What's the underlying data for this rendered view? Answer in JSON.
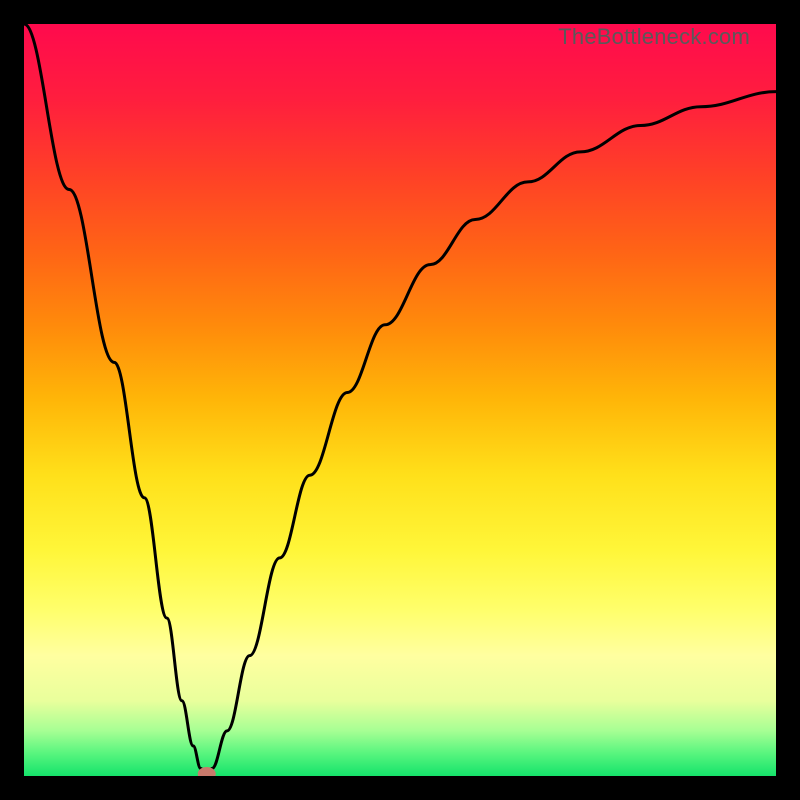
{
  "watermark": "TheBottleneck.com",
  "chart_data": {
    "type": "line",
    "title": "",
    "xlabel": "",
    "ylabel": "",
    "xlim": [
      0,
      100
    ],
    "ylim": [
      0,
      100
    ],
    "gradient_bands": [
      {
        "y": 0,
        "color": "#ff0a4d"
      },
      {
        "y": 10,
        "color": "#ff1e3e"
      },
      {
        "y": 20,
        "color": "#ff4027"
      },
      {
        "y": 30,
        "color": "#ff6316"
      },
      {
        "y": 40,
        "color": "#ff8a0b"
      },
      {
        "y": 50,
        "color": "#ffb608"
      },
      {
        "y": 60,
        "color": "#ffe01a"
      },
      {
        "y": 70,
        "color": "#fff639"
      },
      {
        "y": 78,
        "color": "#ffff6c"
      },
      {
        "y": 84,
        "color": "#ffffa0"
      },
      {
        "y": 90,
        "color": "#e9ff9c"
      },
      {
        "y": 94,
        "color": "#a6ff94"
      },
      {
        "y": 97,
        "color": "#58f57e"
      },
      {
        "y": 100,
        "color": "#15e36b"
      }
    ],
    "series": [
      {
        "name": "bottleneck-curve",
        "data": [
          {
            "x": 0,
            "y": 100
          },
          {
            "x": 6,
            "y": 78
          },
          {
            "x": 12,
            "y": 55
          },
          {
            "x": 16,
            "y": 37
          },
          {
            "x": 19,
            "y": 21
          },
          {
            "x": 21,
            "y": 10
          },
          {
            "x": 22.5,
            "y": 4
          },
          {
            "x": 23.5,
            "y": 1
          },
          {
            "x": 24.3,
            "y": 0
          },
          {
            "x": 25,
            "y": 1
          },
          {
            "x": 27,
            "y": 6
          },
          {
            "x": 30,
            "y": 16
          },
          {
            "x": 34,
            "y": 29
          },
          {
            "x": 38,
            "y": 40
          },
          {
            "x": 43,
            "y": 51
          },
          {
            "x": 48,
            "y": 60
          },
          {
            "x": 54,
            "y": 68
          },
          {
            "x": 60,
            "y": 74
          },
          {
            "x": 67,
            "y": 79
          },
          {
            "x": 74,
            "y": 83
          },
          {
            "x": 82,
            "y": 86.5
          },
          {
            "x": 90,
            "y": 89
          },
          {
            "x": 100,
            "y": 91
          }
        ]
      }
    ],
    "marker": {
      "x": 24.3,
      "y": 0,
      "color": "#c97a6c"
    }
  }
}
